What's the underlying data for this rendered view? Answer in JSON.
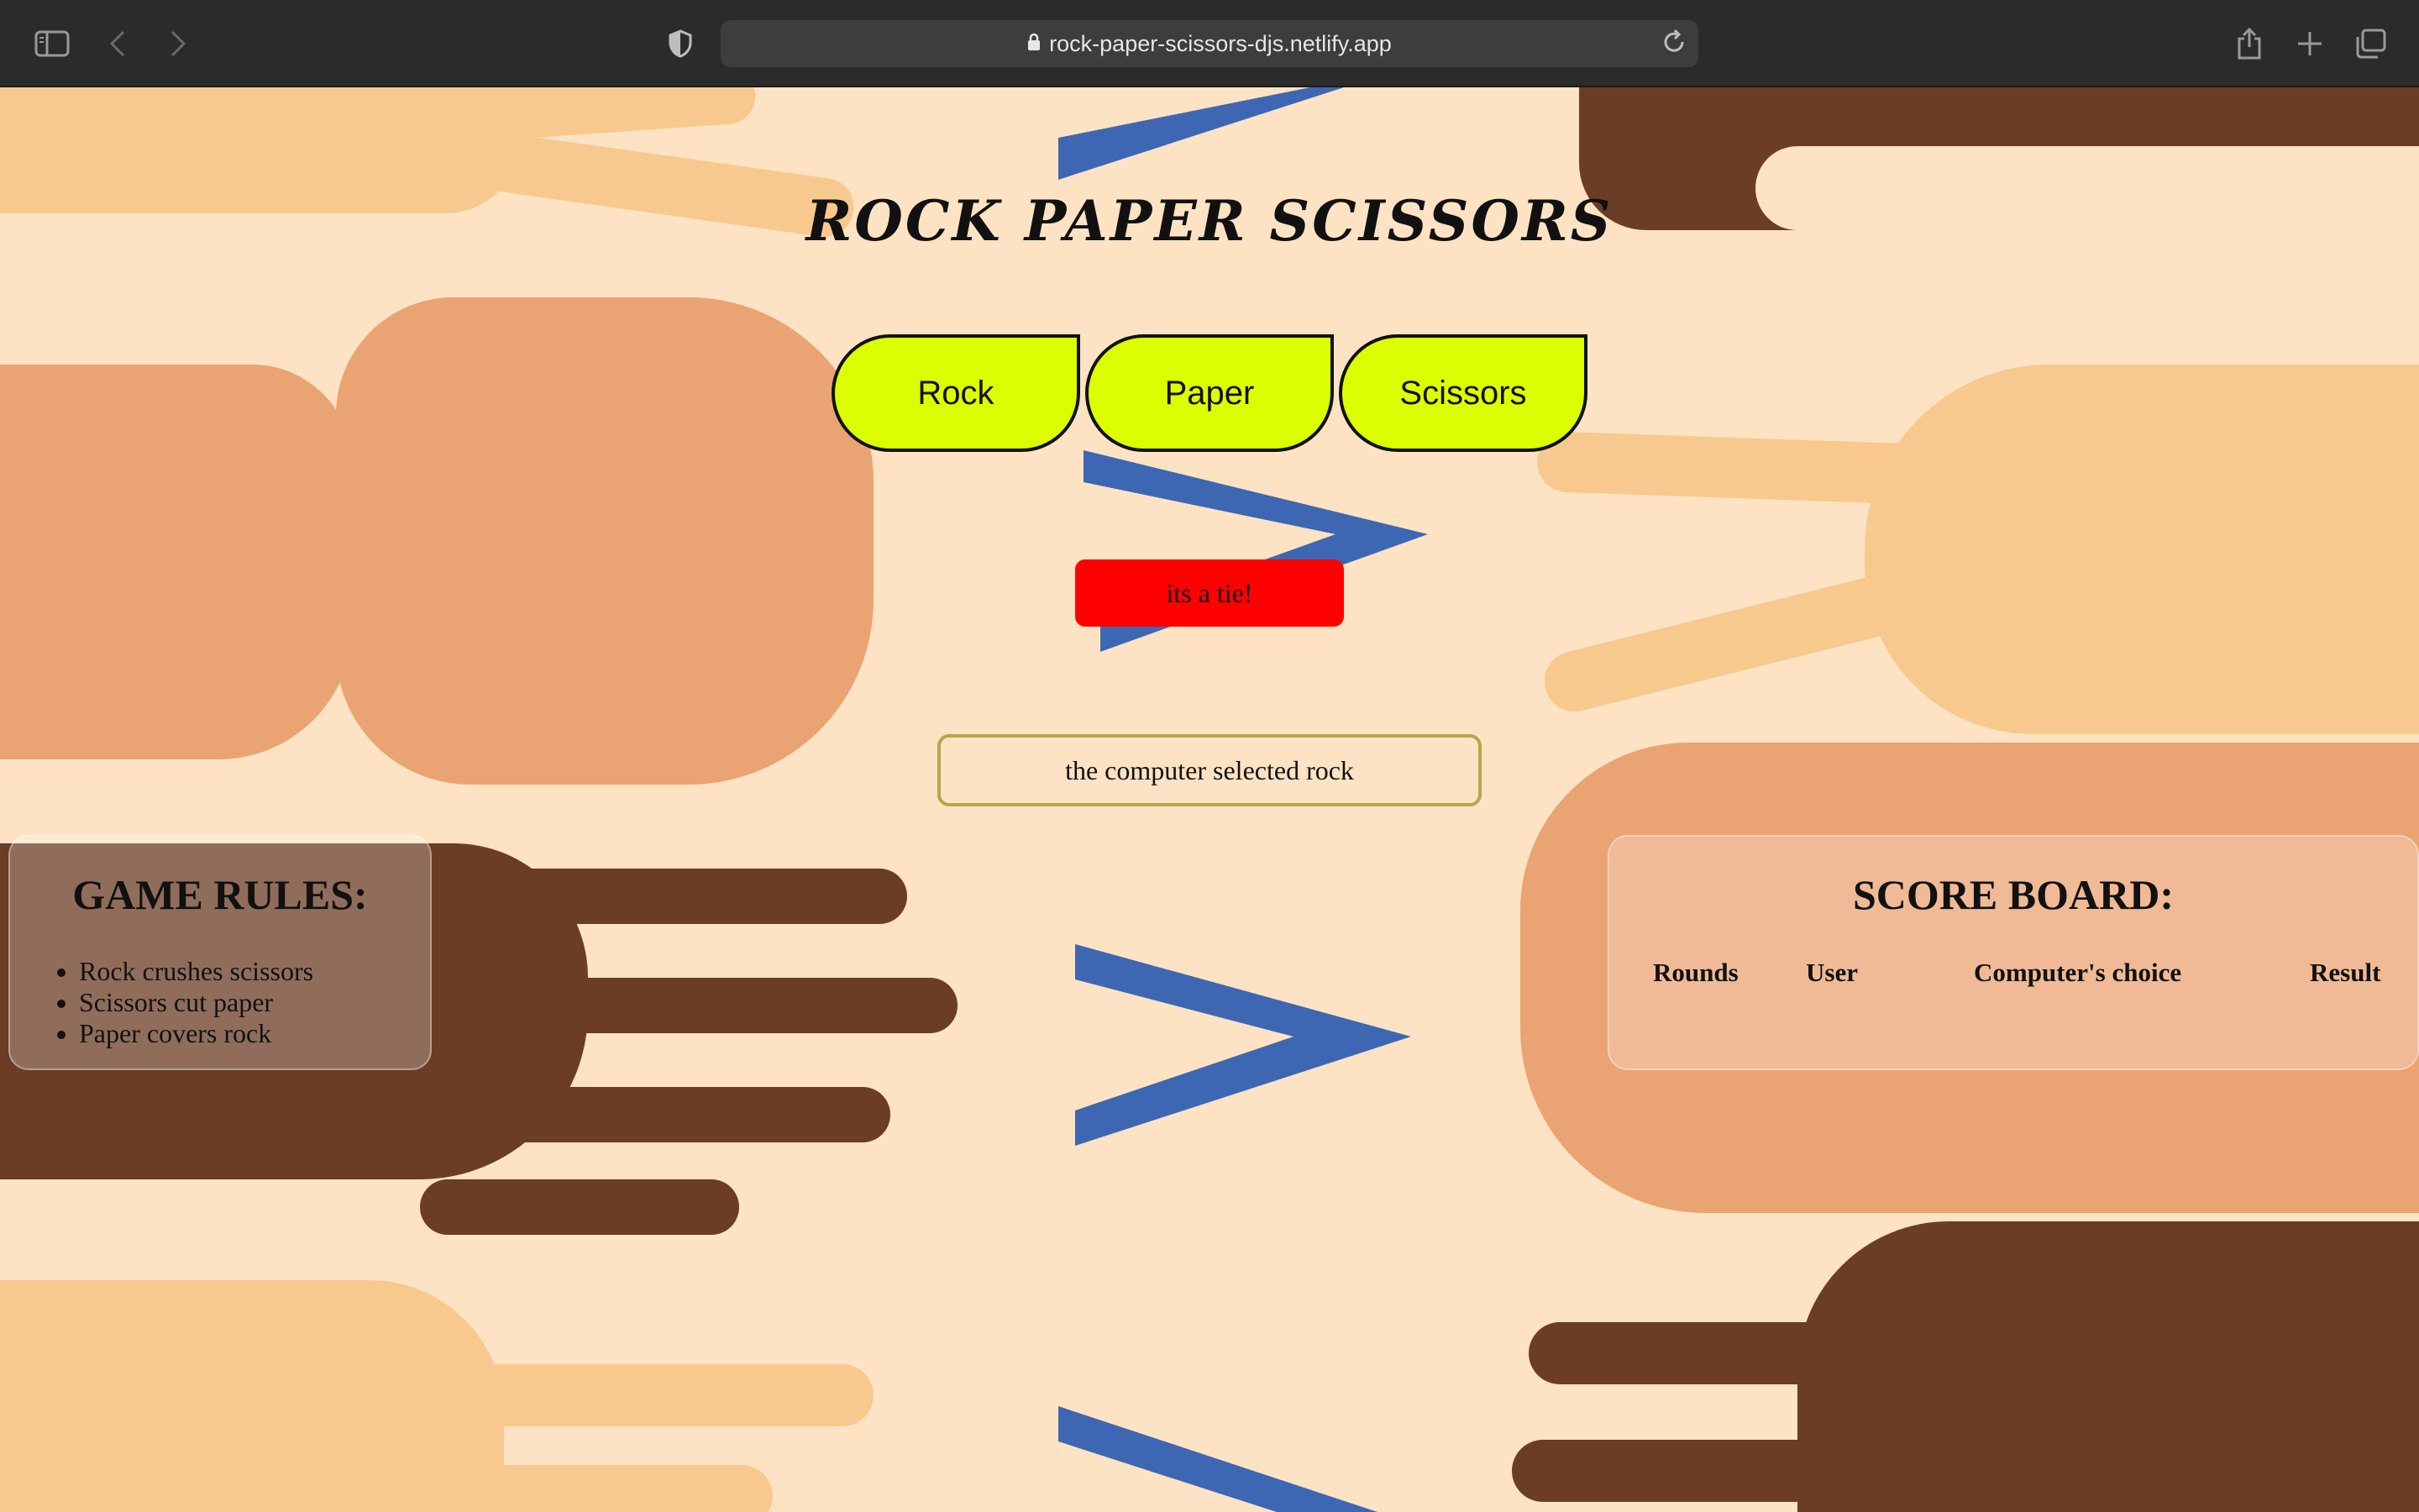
{
  "browser": {
    "url": "rock-paper-scissors-djs.netlify.app"
  },
  "game": {
    "title": "ROCK PAPER SCISSORS",
    "choices": [
      "Rock",
      "Paper",
      "Scissors"
    ],
    "result": "its a tie!",
    "computer_choice_text": "the computer selected rock"
  },
  "rules": {
    "heading": "GAME RULES:",
    "items": [
      "Rock crushes scissors",
      "Scissors cut paper",
      "Paper covers rock"
    ]
  },
  "scoreboard": {
    "heading": "SCORE BOARD:",
    "columns": [
      "Rounds",
      "User",
      "Computer's choice",
      "Result"
    ]
  },
  "colors": {
    "background": "#fde3c3",
    "choice_button": "#dcff00",
    "result_badge": "#ff0000",
    "chevron": "#3d67b2"
  }
}
